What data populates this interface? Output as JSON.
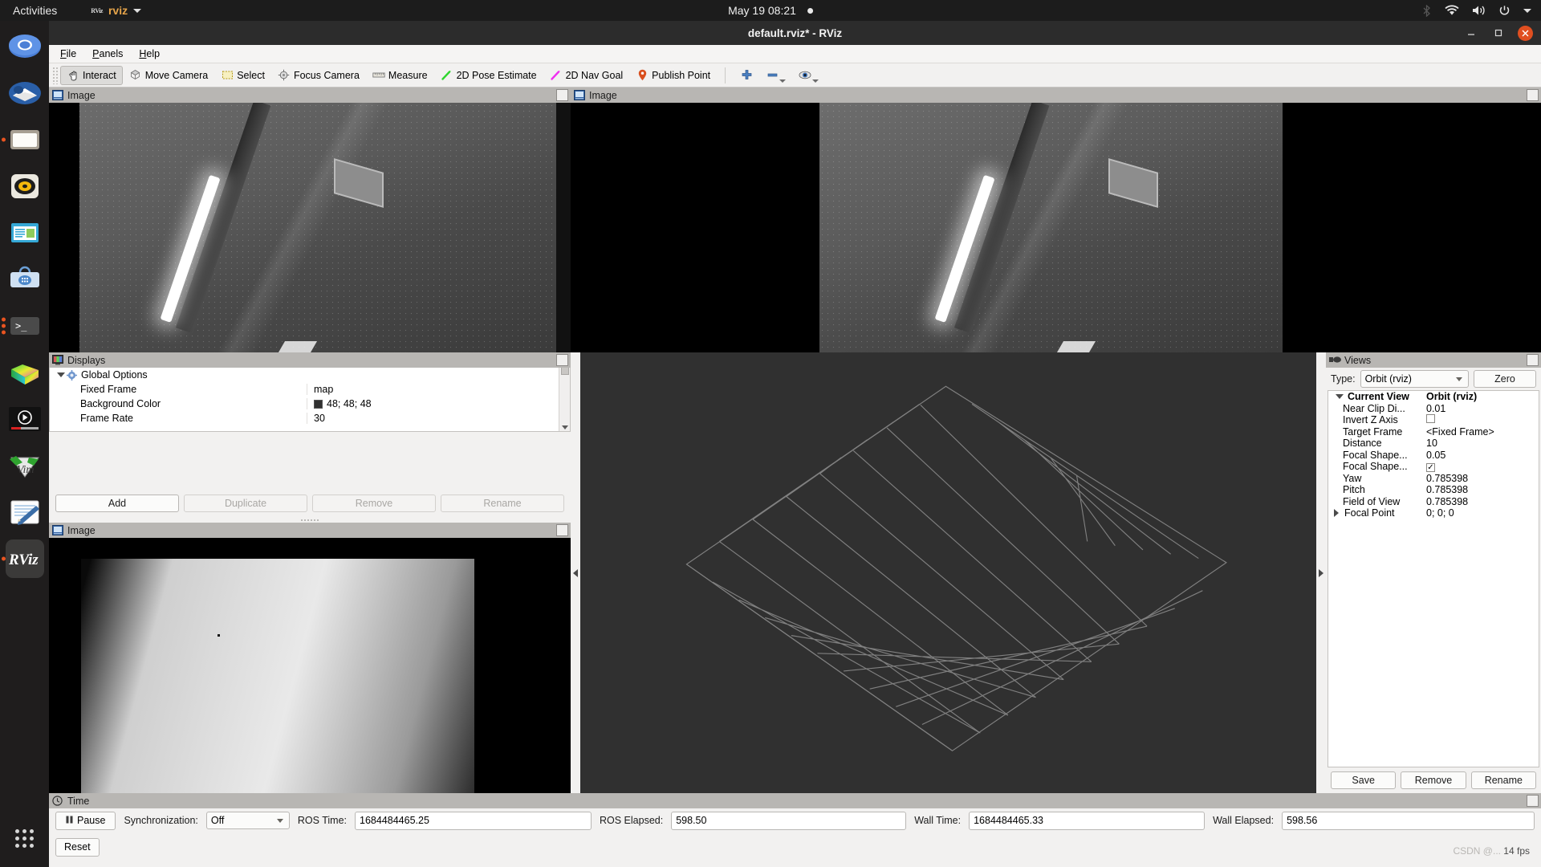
{
  "topbar": {
    "activities": "Activities",
    "app_name": "rviz",
    "app_icon": "rviz-icon",
    "clock": "May 19  08:21",
    "tray_icons": [
      "bluetooth-icon",
      "wifi-icon",
      "volume-icon",
      "power-icon",
      "chevron-down-icon"
    ]
  },
  "dock": {
    "items": [
      {
        "name": "chromium-icon",
        "label": "Chromium",
        "running": false
      },
      {
        "name": "thunderbird-icon",
        "label": "Thunderbird Mail",
        "running": false
      },
      {
        "name": "files-icon",
        "label": "Files",
        "running": true
      },
      {
        "name": "rhythmbox-icon",
        "label": "Rhythmbox",
        "running": false
      },
      {
        "name": "libreoffice-writer-icon",
        "label": "LibreOffice Writer",
        "running": false
      },
      {
        "name": "software-icon",
        "label": "Ubuntu Software",
        "running": false
      },
      {
        "name": "terminal-icon",
        "label": "Terminal",
        "running": true
      },
      {
        "name": "color-cube-icon",
        "label": "Color Picker",
        "running": false
      },
      {
        "name": "media-player-icon",
        "label": "Video Player",
        "running": false
      },
      {
        "name": "vim-icon",
        "label": "Vim",
        "running": false
      },
      {
        "name": "text-editor-icon",
        "label": "Text Editor",
        "running": false
      },
      {
        "name": "rviz-dock-icon",
        "label": "RViz",
        "running": true
      }
    ],
    "show_apps_label": "Show Applications"
  },
  "window": {
    "title": "default.rviz* - RViz",
    "minimize": "–",
    "maximize": "❐",
    "close": "✕"
  },
  "menubar": {
    "items": [
      {
        "label": "File",
        "mnemonic": "F"
      },
      {
        "label": "Panels",
        "mnemonic": "P"
      },
      {
        "label": "Help",
        "mnemonic": "H"
      }
    ]
  },
  "toolbar": {
    "tools": [
      {
        "label": "Interact",
        "icon": "hand-cursor-icon",
        "active": true
      },
      {
        "label": "Move Camera",
        "icon": "move-camera-icon",
        "active": false
      },
      {
        "label": "Select",
        "icon": "select-rectangle-icon",
        "active": false
      },
      {
        "label": "Focus Camera",
        "icon": "focus-camera-icon",
        "active": false
      },
      {
        "label": "Measure",
        "icon": "ruler-icon",
        "active": false
      },
      {
        "label": "2D Pose Estimate",
        "icon": "green-arrow-icon",
        "active": false
      },
      {
        "label": "2D Nav Goal",
        "icon": "magenta-arrow-icon",
        "active": false
      },
      {
        "label": "Publish Point",
        "icon": "map-pin-icon",
        "active": false
      }
    ],
    "extra": [
      {
        "name": "add-tool-button",
        "icon": "plus-icon"
      },
      {
        "name": "remove-tool-button",
        "icon": "minus-icon",
        "has_dropdown": true
      },
      {
        "name": "tool-visibility-button",
        "icon": "eye-icon",
        "has_dropdown": true
      }
    ]
  },
  "image_panels": {
    "top_left": {
      "title": "Image",
      "icon": "image-display-icon"
    },
    "top_right": {
      "title": "Image",
      "icon": "image-display-icon"
    },
    "bottom_left": {
      "title": "Image",
      "icon": "image-display-icon"
    }
  },
  "displays": {
    "title": "Displays",
    "icon": "displays-icon",
    "tree": [
      {
        "label": "Global Options",
        "value": "",
        "depth": 0,
        "expanded": true,
        "icon": "gear-icon"
      },
      {
        "label": "Fixed Frame",
        "value": "map",
        "depth": 1
      },
      {
        "label": "Background Color",
        "value": "48; 48; 48",
        "depth": 1,
        "swatch": "#303030"
      },
      {
        "label": "Frame Rate",
        "value": "30",
        "depth": 1
      }
    ],
    "buttons": [
      {
        "label": "Add",
        "enabled": true
      },
      {
        "label": "Duplicate",
        "enabled": false
      },
      {
        "label": "Remove",
        "enabled": false
      },
      {
        "label": "Rename",
        "enabled": false
      }
    ]
  },
  "views": {
    "title": "Views",
    "icon": "views-icon",
    "type_label": "Type:",
    "type_value": "Orbit (rviz)",
    "zero_button": "Zero",
    "tree": [
      {
        "label": "Current View",
        "value": "Orbit (rviz)",
        "bold": true,
        "twisty": "open"
      },
      {
        "label": "Near Clip Di...",
        "value": "0.01"
      },
      {
        "label": "Invert Z Axis",
        "value": "",
        "checkbox": false
      },
      {
        "label": "Target Frame",
        "value": "<Fixed Frame>"
      },
      {
        "label": "Distance",
        "value": "10"
      },
      {
        "label": "Focal Shape...",
        "value": "0.05"
      },
      {
        "label": "Focal Shape...",
        "value": "",
        "checkbox": true
      },
      {
        "label": "Yaw",
        "value": "0.785398"
      },
      {
        "label": "Pitch",
        "value": "0.785398"
      },
      {
        "label": "Field of View",
        "value": "0.785398"
      },
      {
        "label": "Focal Point",
        "value": "0; 0; 0",
        "twisty": "closed"
      }
    ],
    "buttons": [
      {
        "label": "Save"
      },
      {
        "label": "Remove"
      },
      {
        "label": "Rename"
      }
    ]
  },
  "time": {
    "title": "Time",
    "icon": "clock-icon",
    "pause_label": "Pause",
    "reset_label": "Reset",
    "sync_label": "Synchronization:",
    "sync_value": "Off",
    "ros_time_label": "ROS Time:",
    "ros_time_value": "1684484465.25",
    "ros_elapsed_label": "ROS Elapsed:",
    "ros_elapsed_value": "598.50",
    "wall_time_label": "Wall Time:",
    "wall_time_value": "1684484465.33",
    "wall_elapsed_label": "Wall Elapsed:",
    "wall_elapsed_value": "598.56"
  },
  "status": {
    "fps": "14 fps",
    "watermark": "CSDN @..."
  },
  "colors": {
    "accent_orange": "#e95420",
    "panel_bg": "#f2f1f0",
    "panel_header": "#b8b6b3",
    "view3d_bg": "#303030",
    "titlebar": "#2c2c2c"
  }
}
